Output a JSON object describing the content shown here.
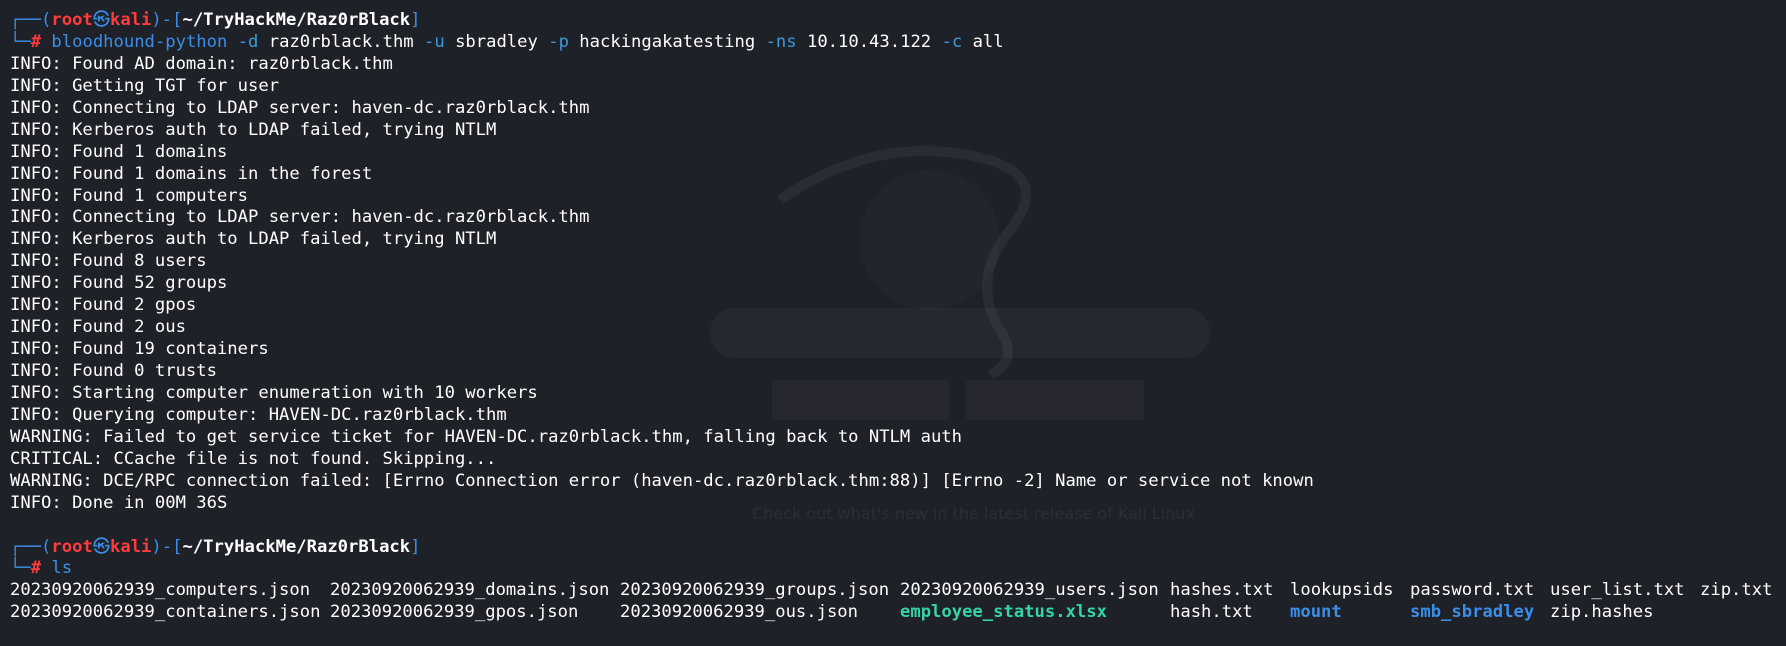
{
  "prompt": {
    "top_left": "┌──(",
    "user": "root",
    "skull": "㉿",
    "host": "kali",
    "mid": ")-[",
    "path": "~/TryHackMe/Raz0rBlack",
    "end": "]",
    "bottom_left": "└─",
    "hash": "#"
  },
  "command1": {
    "program": "bloodhound-python",
    "parts": [
      {
        "flag": "-d",
        "value": "raz0rblack.thm"
      },
      {
        "flag": "-u",
        "value": "sbradley"
      },
      {
        "flag": "-p",
        "value": "hackingakatesting"
      },
      {
        "flag": "-ns",
        "value": "10.10.43.122"
      },
      {
        "flag": "-c",
        "value": "all"
      }
    ]
  },
  "output": [
    "INFO: Found AD domain: raz0rblack.thm",
    "INFO: Getting TGT for user",
    "INFO: Connecting to LDAP server: haven-dc.raz0rblack.thm",
    "INFO: Kerberos auth to LDAP failed, trying NTLM",
    "INFO: Found 1 domains",
    "INFO: Found 1 domains in the forest",
    "INFO: Found 1 computers",
    "INFO: Connecting to LDAP server: haven-dc.raz0rblack.thm",
    "INFO: Kerberos auth to LDAP failed, trying NTLM",
    "INFO: Found 8 users",
    "INFO: Found 52 groups",
    "INFO: Found 2 gpos",
    "INFO: Found 2 ous",
    "INFO: Found 19 containers",
    "INFO: Found 0 trusts",
    "INFO: Starting computer enumeration with 10 workers",
    "INFO: Querying computer: HAVEN-DC.raz0rblack.thm",
    "WARNING: Failed to get service ticket for HAVEN-DC.raz0rblack.thm, falling back to NTLM auth",
    "CRITICAL: CCache file is not found. Skipping...",
    "WARNING: DCE/RPC connection failed: [Errno Connection error (haven-dc.raz0rblack.thm:88)] [Errno -2] Name or service not known",
    "INFO: Done in 00M 36S"
  ],
  "command2": "ls",
  "ls": {
    "row1": [
      {
        "name": "20230920062939_computers.json",
        "type": "file"
      },
      {
        "name": "20230920062939_domains.json",
        "type": "file"
      },
      {
        "name": "20230920062939_groups.json",
        "type": "file"
      },
      {
        "name": "20230920062939_users.json",
        "type": "file"
      },
      {
        "name": "hashes.txt",
        "type": "file"
      },
      {
        "name": "lookupsids",
        "type": "file"
      },
      {
        "name": "password.txt",
        "type": "file"
      },
      {
        "name": "user_list.txt",
        "type": "file"
      },
      {
        "name": "zip.txt",
        "type": "file"
      }
    ],
    "row2": [
      {
        "name": "20230920062939_containers.json",
        "type": "file"
      },
      {
        "name": "20230920062939_gpos.json",
        "type": "file"
      },
      {
        "name": "20230920062939_ous.json",
        "type": "file"
      },
      {
        "name": "employee_status.xlsx",
        "type": "exec"
      },
      {
        "name": "hash.txt",
        "type": "file"
      },
      {
        "name": "mount",
        "type": "dir"
      },
      {
        "name": "smb_sbradley",
        "type": "dir"
      },
      {
        "name": "zip.hashes",
        "type": "file"
      },
      {
        "name": "",
        "type": "file"
      }
    ]
  },
  "colors": {
    "background": "#1f2129",
    "prompt_frame": "#3a8ee8",
    "user_host": "#ff3b3b",
    "exec_file": "#36d4a7",
    "directory": "#3a8ee8"
  },
  "wallpaper": {
    "caption": "Check out what's new in the latest release of Kali Linux"
  }
}
